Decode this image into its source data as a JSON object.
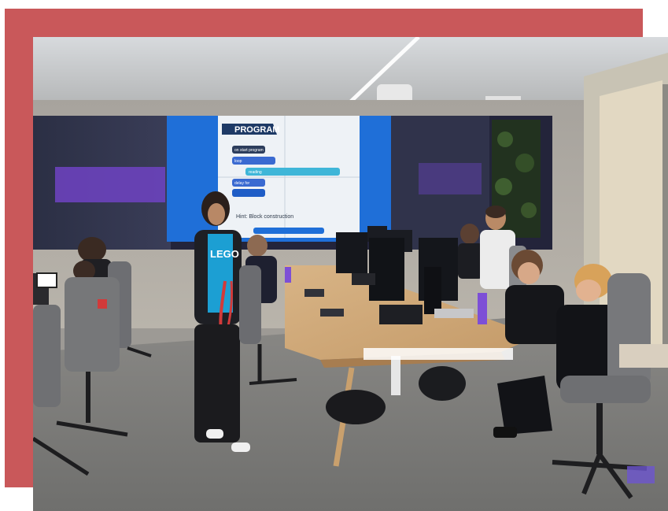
{
  "image": {
    "frame_color": "#c9585a"
  },
  "screen": {
    "program_title": "PROGRAM",
    "hint_text": "Hint: Block construction",
    "block_labels": [
      "on start program",
      "loop",
      "reading",
      "delay for"
    ]
  },
  "shirt": {
    "logo_text": "LEGO"
  }
}
